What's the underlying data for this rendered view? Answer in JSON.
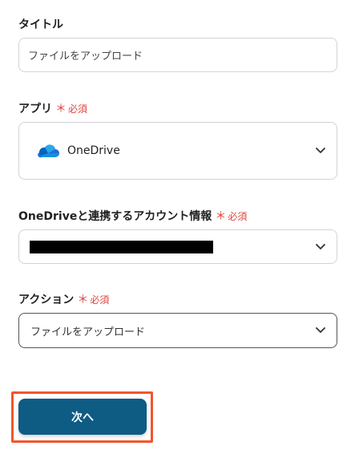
{
  "form": {
    "title": {
      "label": "タイトル",
      "value": "ファイルをアップロード"
    },
    "app": {
      "label": "アプリ",
      "required_text": "必須",
      "value": "OneDrive",
      "icon": "onedrive-cloud-icon",
      "icon_color": "#1e88e5"
    },
    "account": {
      "label": "OneDriveと連携するアカウント情報",
      "required_text": "必須"
    },
    "action": {
      "label": "アクション",
      "required_text": "必須",
      "value": "ファイルをアップロード"
    }
  },
  "required_mark": "＊",
  "next_button": {
    "label": "次へ",
    "color": "#0e5b84",
    "highlight_color": "#f2552c"
  }
}
